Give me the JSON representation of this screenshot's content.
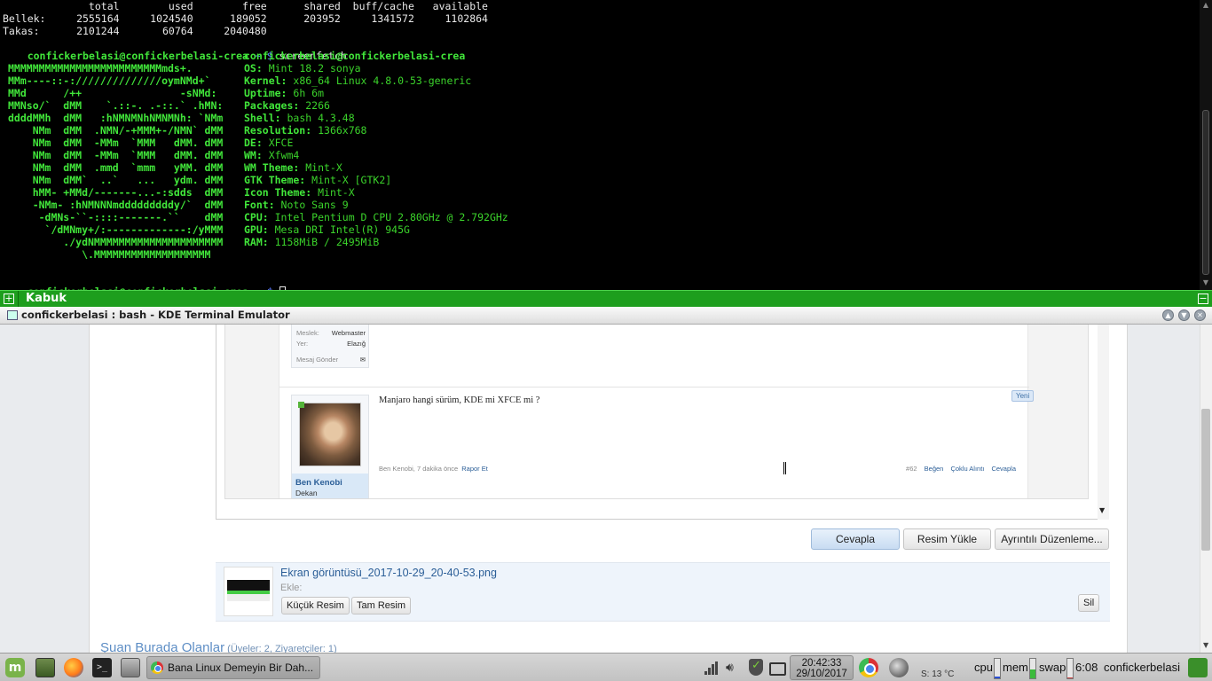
{
  "terminal": {
    "mem_header": "              total        used        free      shared  buff/cache   available",
    "mem_row": "Bellek:     2555164     1024540      189052      203952     1341572     1102864",
    "swap_row": "Takas:      2101244       60764     2040480",
    "prompt_user": "confickerbelasi@confickerbelasi-crea",
    "prompt_dir": " ~ $ ",
    "command": "screenfetch",
    "logo_lines": [
      "MMMMMMMMMMMMMMMMMMMMMMMMMmds+.",
      "MMm----::-://////////////oymNMd+`",
      "MMd      /++                -sNMd:",
      "MMNso/`  dMM    `.::-. .-::.` .hMN:",
      "ddddMMh  dMM   :hNMNMNhNMNMNh: `NMm",
      "    NMm  dMM  .NMN/-+MMM+-/NMN` dMM",
      "    NMm  dMM  -MMm  `MMM   dMM. dMM",
      "    NMm  dMM  -MMm  `MMM   dMM. dMM",
      "    NMm  dMM  .mmd  `mmm   yMM. dMM",
      "    NMm  dMM`  ..`   ...   ydm. dMM",
      "    hMM- +MMd/-------...-:sdds  dMM",
      "    -NMm- :hNMNNNmdddddddddy/`  dMM",
      "     -dMNs-``-::::-------.``    dMM",
      "      `/dMNmy+/:-------------:/yMMM",
      "         ./ydNMMMMMMMMMMMMMMMMMMMMM",
      "            \\.MMMMMMMMMMMMMMMMMMM"
    ],
    "info_title": "confickerbelasi@confickerbelasi-crea",
    "info": [
      {
        "key": "OS:",
        "value": " Mint 18.2 sonya"
      },
      {
        "key": "Kernel:",
        "value": " x86_64 Linux 4.8.0-53-generic"
      },
      {
        "key": "Uptime:",
        "value": " 6h 6m"
      },
      {
        "key": "Packages:",
        "value": " 2266"
      },
      {
        "key": "Shell:",
        "value": " bash 4.3.48"
      },
      {
        "key": "Resolution:",
        "value": " 1366x768"
      },
      {
        "key": "DE:",
        "value": " XFCE"
      },
      {
        "key": "WM:",
        "value": " Xfwm4"
      },
      {
        "key": "WM Theme:",
        "value": " Mint-X"
      },
      {
        "key": "GTK Theme:",
        "value": " Mint-X [GTK2]"
      },
      {
        "key": "Icon Theme:",
        "value": " Mint-X"
      },
      {
        "key": "Font:",
        "value": " Noto Sans 9"
      },
      {
        "key": "CPU:",
        "value": " Intel Pentium D CPU 2.80GHz @ 2.792GHz"
      },
      {
        "key": "GPU:",
        "value": " Mesa DRI Intel(R) 945G"
      },
      {
        "key": "RAM:",
        "value": " 1158MiB / 2495MiB"
      }
    ]
  },
  "tabbar": {
    "add": "+",
    "tab_label": "Kabuk",
    "minimize": "−"
  },
  "window": {
    "title": "confickerbelasi : bash - KDE Terminal Emulator"
  },
  "forum": {
    "prev_user_fields": [
      {
        "label": "Meslek:",
        "value": "Webmaster"
      },
      {
        "label": "Yer:",
        "value": "Elazığ"
      },
      {
        "label": "Mesaj Gönder",
        "value": "✉"
      }
    ],
    "post": {
      "author": "Ben Kenobi",
      "rank": "Dekan",
      "text": "Manjaro hangi sürüm, KDE mi XFCE mi ?",
      "badge": "Yeni",
      "meta": "Ben Kenobi, 7 dakika önce",
      "report": "Rapor Et",
      "number": "#62",
      "like": "Beğen",
      "multi_quote": "Çoklu Alıntı",
      "reply": "Cevapla"
    },
    "buttons": {
      "reply": "Cevapla",
      "upload_image": "Resim Yükle",
      "advanced_edit": "Ayrıntılı Düzenleme..."
    },
    "attachment": {
      "filename": "Ekran görüntüsü_2017-10-29_20-40-53.png",
      "insert_label": "Ekle:",
      "thumbnail_button": "Küçük Resim",
      "full_image_button": "Tam Resim",
      "delete_button": "Sil"
    },
    "online": {
      "title": "Şuan Burada Olanlar",
      "sub": " (Üyeler: 2, Ziyaretçiler: 1)"
    }
  },
  "taskbar": {
    "mint_menu": "m",
    "terminal_glyph": ">_",
    "window_title": "Bana Linux Demeyin Bir Dah...",
    "clock_time": "20:42:33",
    "clock_date": "29/10/2017",
    "temperature": "S: 13 °C",
    "cpu_label": "cpu",
    "mem_label": "mem",
    "swap_label": "swap",
    "uptime": "6:08",
    "username": "confickerbelasi",
    "cpu_level": 0.1,
    "mem_level": 0.45,
    "swap_level": 0.03
  },
  "colors": {
    "terminal_green": "#3bd32b",
    "tabbar_green": "#1d9e1d",
    "link_blue": "#2b5e97"
  }
}
